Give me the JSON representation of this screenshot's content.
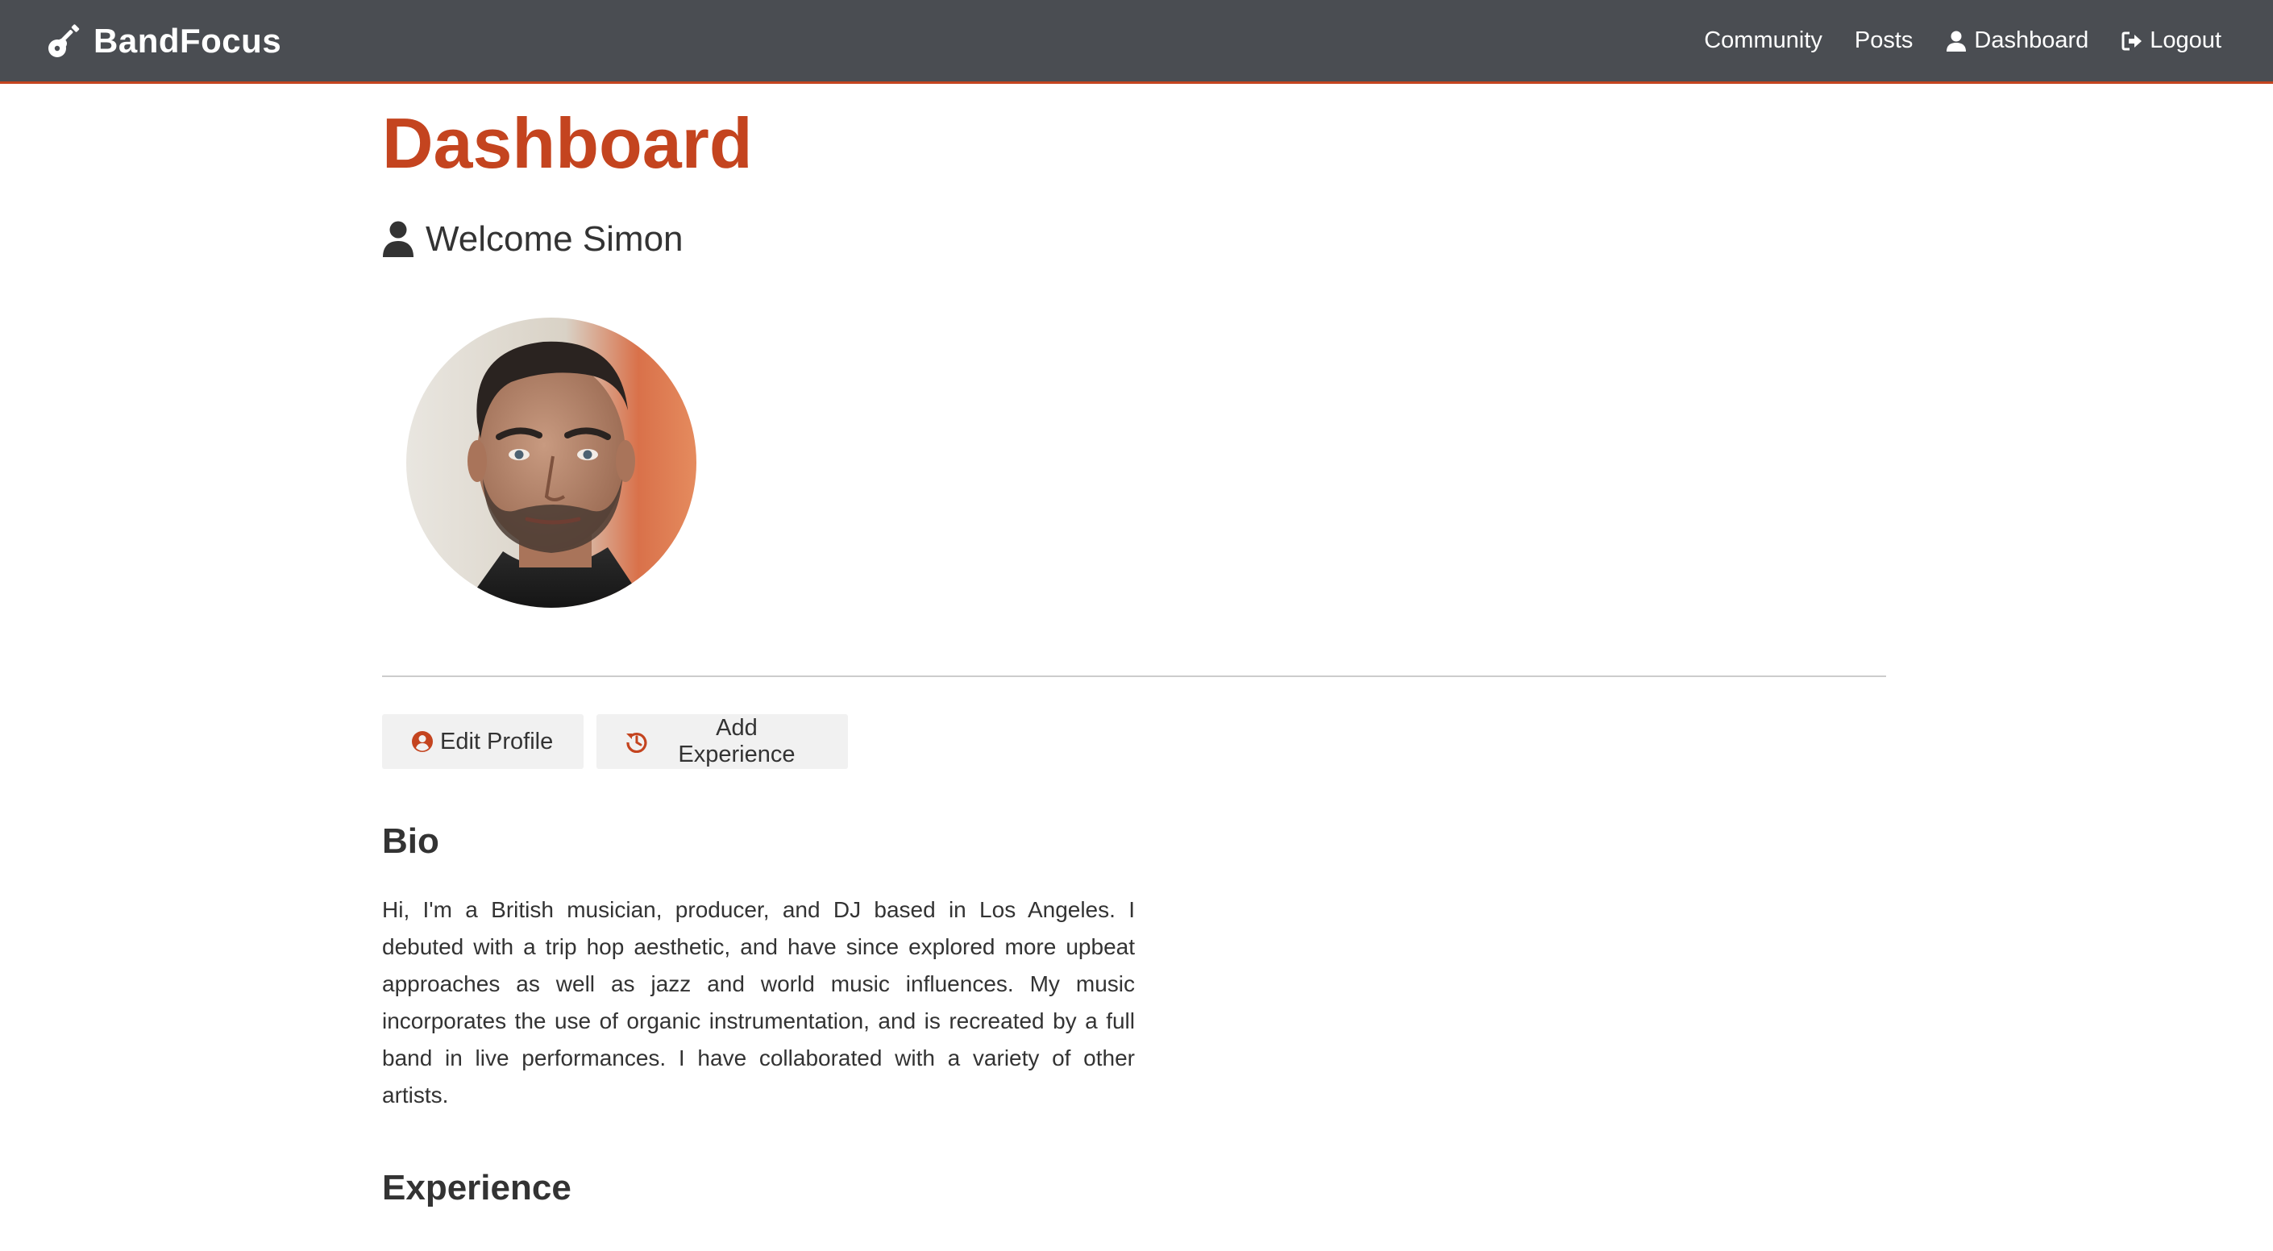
{
  "navbar": {
    "brand": "BandFocus",
    "brand_icon": "guitar-icon",
    "links": [
      {
        "label": "Community",
        "icon": null
      },
      {
        "label": "Posts",
        "icon": null
      },
      {
        "label": "Dashboard",
        "icon": "user-icon"
      },
      {
        "label": "Logout",
        "icon": "sign-out-icon"
      }
    ]
  },
  "main": {
    "title": "Dashboard",
    "welcome": "Welcome Simon",
    "welcome_icon": "user-icon",
    "avatar_alt": "profile-photo",
    "actions": {
      "edit_profile": "Edit Profile",
      "edit_profile_icon": "user-circle-icon",
      "add_experience": "Add Experience",
      "add_experience_icon": "history-icon"
    },
    "bio_heading": "Bio",
    "bio_text": "Hi, I'm a British musician, producer, and DJ based in Los Angeles. I debuted with a trip hop aesthetic, and have since explored more upbeat approaches as well as jazz and world music influences. My music incorporates the use of organic instrumentation, and is recreated by a full band in live performances. I have collaborated with a variety of other artists.",
    "experience_heading": "Experience"
  },
  "colors": {
    "accent": "#c4441f",
    "navbar_bg": "#4a4d52",
    "button_bg": "#f1f1f1",
    "text": "#333333"
  }
}
